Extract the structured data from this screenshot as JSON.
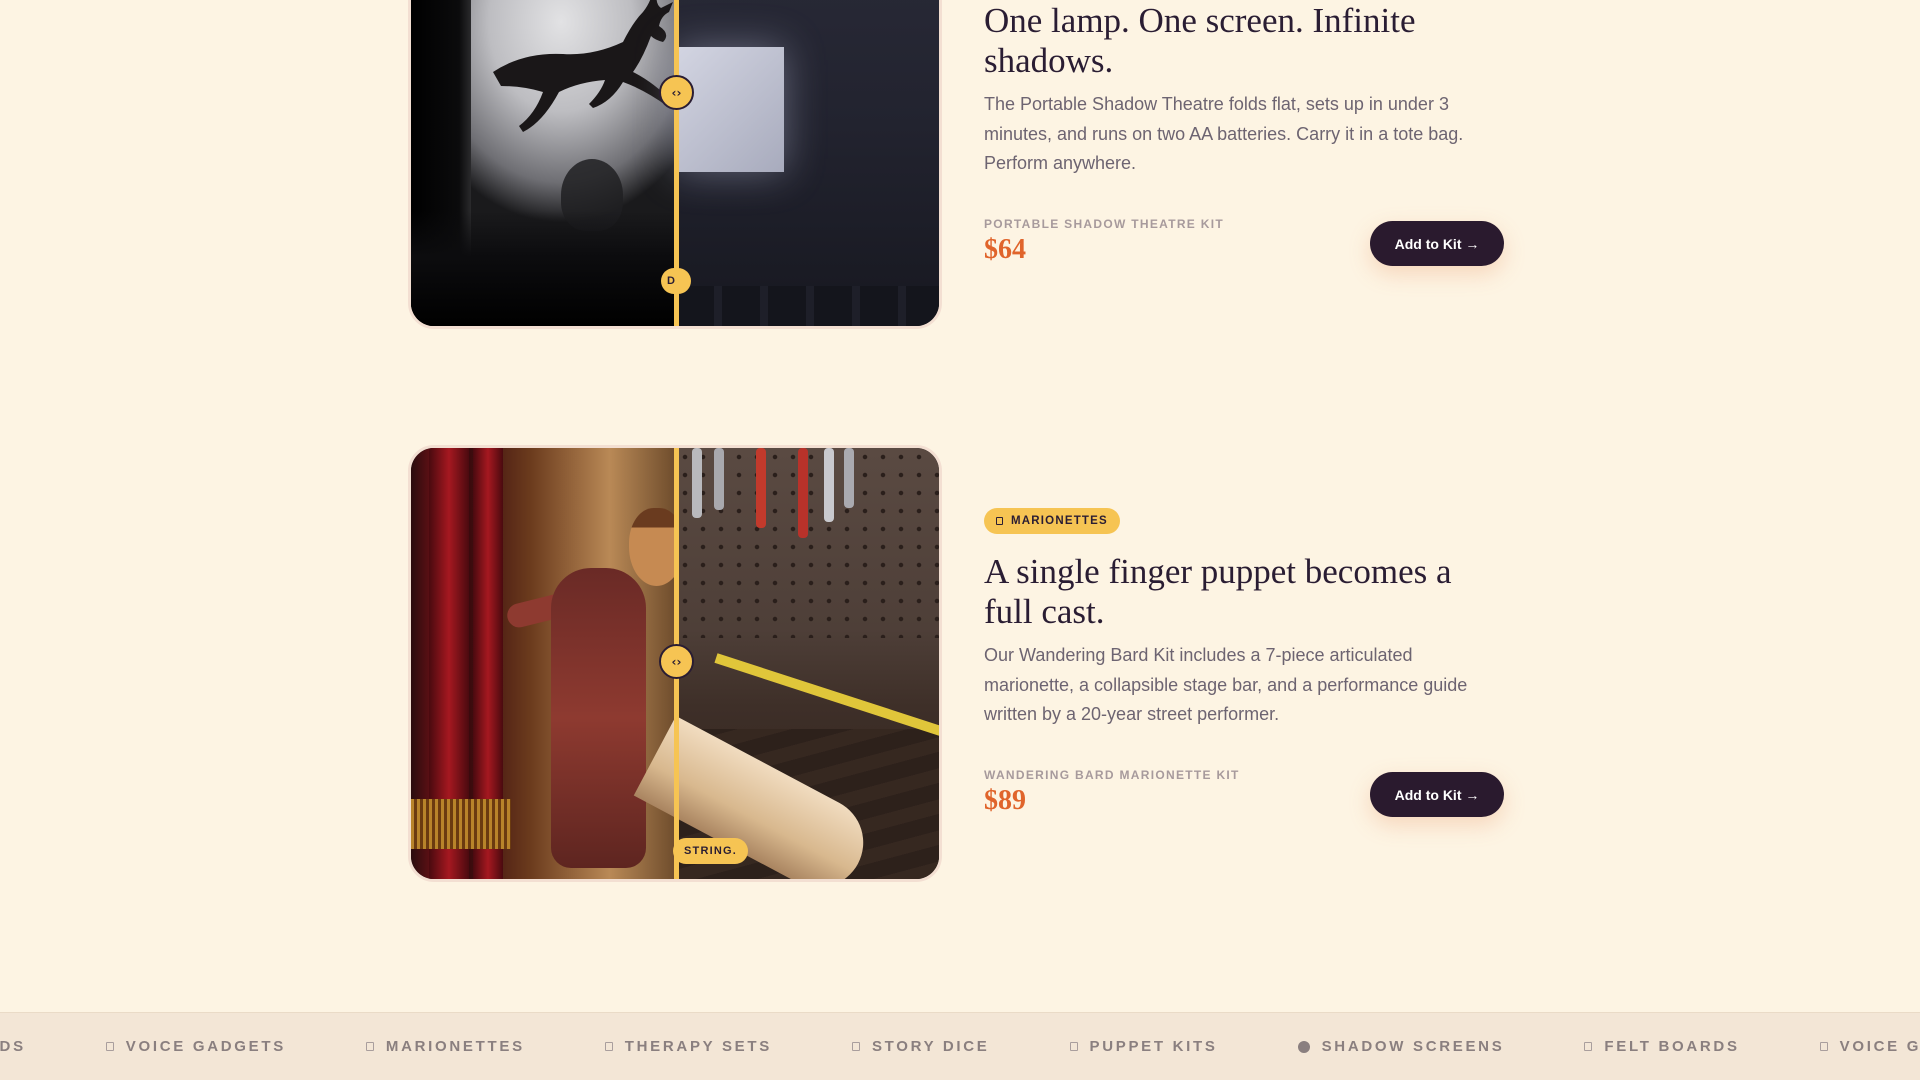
{
  "products": [
    {
      "badge": "",
      "title": "One lamp. One screen. Infinite shadows.",
      "description": "The Portable Shadow Theatre folds flat, sets up in under 3 minutes, and runs on two AA batteries. Carry it in a tote bag. Perform anywhere.",
      "kit_label": "PORTABLE SHADOW THEATRE KIT",
      "price": "$64",
      "cta": "Add to Kit →",
      "compare_handle_icon": "‹›",
      "compare_caption": "D",
      "slider_position": 0.5
    },
    {
      "badge": "MARIONETTES",
      "title": "A single finger puppet becomes a full cast.",
      "description": "Our Wandering Bard Kit includes a 7-piece articulated marionette, a collapsible stage bar, and a performance guide written by a 20-year street performer.",
      "kit_label": "WANDERING BARD MARIONETTE KIT",
      "price": "$89",
      "cta": "Add to Kit →",
      "compare_handle_icon": "‹›",
      "compare_caption": "STRING.",
      "slider_position": 0.5
    }
  ],
  "ticker": {
    "items": [
      {
        "label": "RDS",
        "icon": "box-icon"
      },
      {
        "label": "VOICE GADGETS",
        "icon": "box-icon"
      },
      {
        "label": "MARIONETTES",
        "icon": "box-icon"
      },
      {
        "label": "THERAPY SETS",
        "icon": "box-icon"
      },
      {
        "label": "STORY DICE",
        "icon": "box-icon"
      },
      {
        "label": "PUPPET KITS",
        "icon": "box-icon"
      },
      {
        "label": "SHADOW SCREENS",
        "icon": "dot-icon"
      },
      {
        "label": "FELT BOARDS",
        "icon": "box-icon"
      },
      {
        "label": "VOICE GADG",
        "icon": "box-icon"
      }
    ]
  },
  "colors": {
    "background": "#fdf4e3",
    "accent_yellow": "#f6c453",
    "price_orange": "#e0642b",
    "button_dark": "#2a1a2e"
  }
}
